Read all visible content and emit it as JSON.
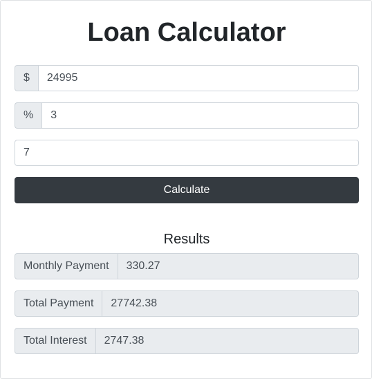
{
  "page": {
    "title": "Loan Calculator"
  },
  "form": {
    "amount": {
      "prefix": "$",
      "value": "24995"
    },
    "interest": {
      "prefix": "%",
      "value": "3"
    },
    "years": {
      "value": "7"
    },
    "calculate_label": "Calculate"
  },
  "results": {
    "heading": "Results",
    "rows": [
      {
        "label": "Monthly Payment",
        "value": "330.27"
      },
      {
        "label": "Total Payment",
        "value": "27742.38"
      },
      {
        "label": "Total Interest",
        "value": "2747.38"
      }
    ]
  },
  "colors": {
    "button_bg": "#343a40",
    "addon_bg": "#e9ecef",
    "border": "#ced4da"
  }
}
